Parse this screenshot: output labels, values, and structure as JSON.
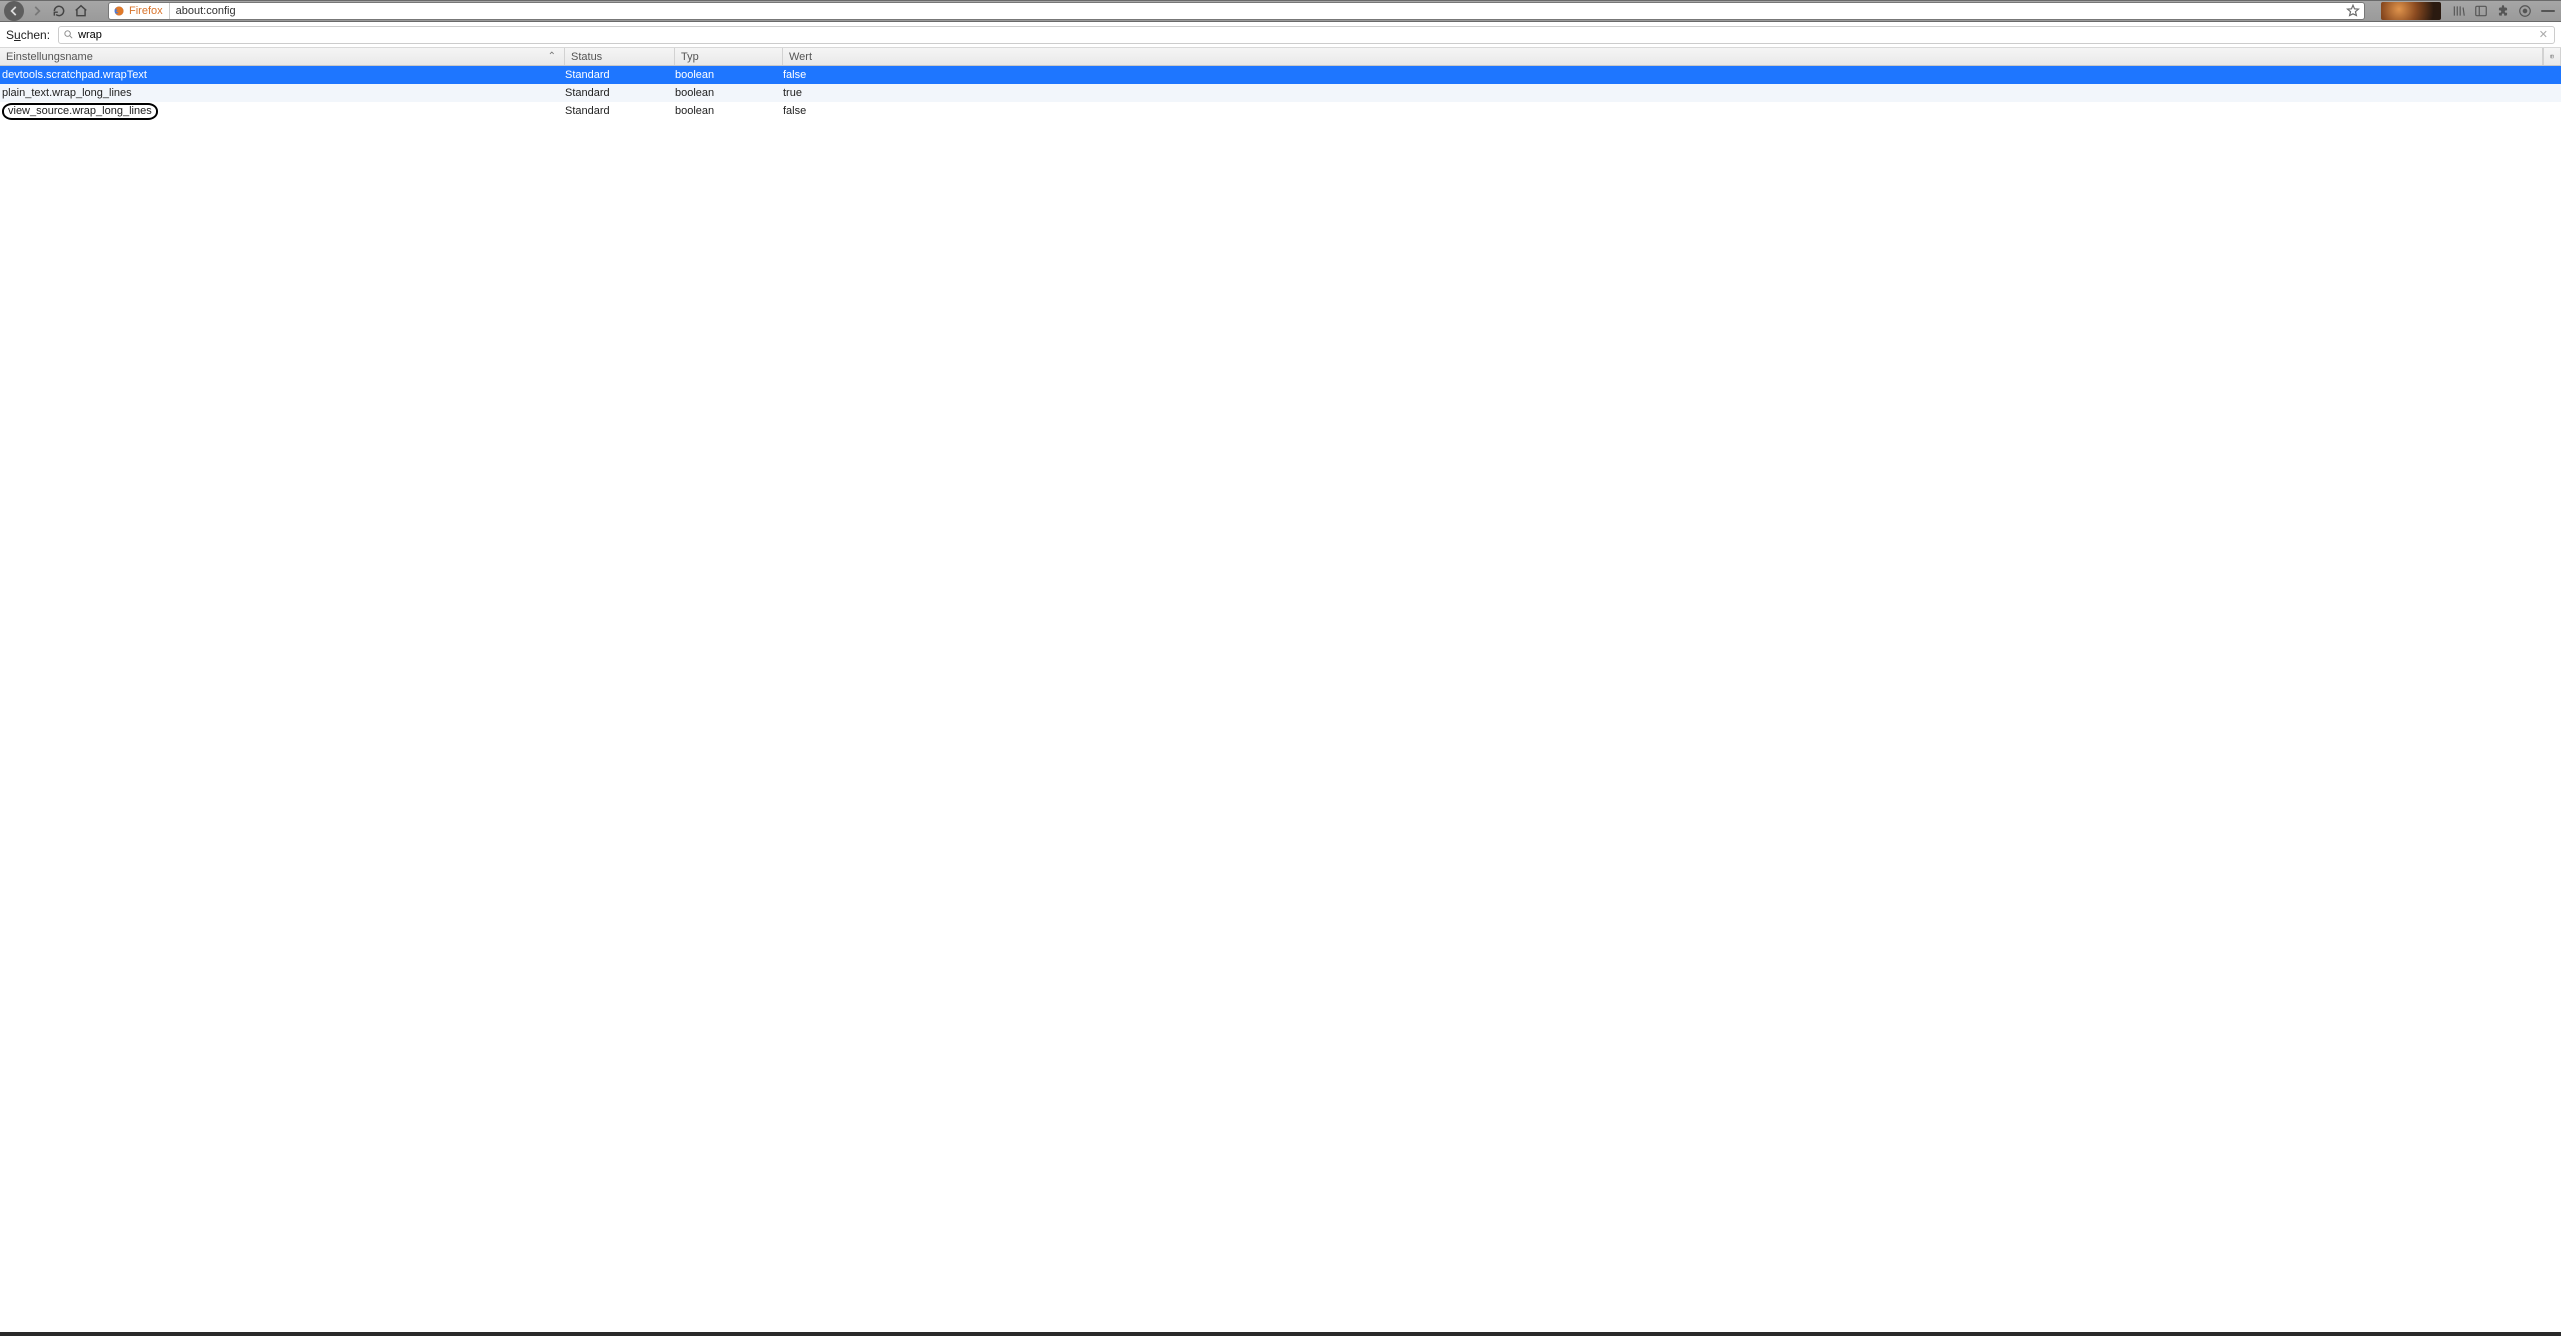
{
  "nav": {
    "identity_label": "Firefox",
    "url": "about:config"
  },
  "search": {
    "label_pre": "S",
    "label_underlined": "u",
    "label_post": "chen:",
    "value": "wrap"
  },
  "columns": {
    "name": "Einstellungsname",
    "status": "Status",
    "type": "Typ",
    "value": "Wert"
  },
  "rows": [
    {
      "name": "devtools.scratchpad.wrapText",
      "status": "Standard",
      "type": "boolean",
      "value": "false",
      "selected": true,
      "circled": false
    },
    {
      "name": "plain_text.wrap_long_lines",
      "status": "Standard",
      "type": "boolean",
      "value": "true",
      "selected": false,
      "circled": false,
      "alt": true
    },
    {
      "name": "view_source.wrap_long_lines",
      "status": "Standard",
      "type": "boolean",
      "value": "false",
      "selected": false,
      "circled": true
    }
  ]
}
